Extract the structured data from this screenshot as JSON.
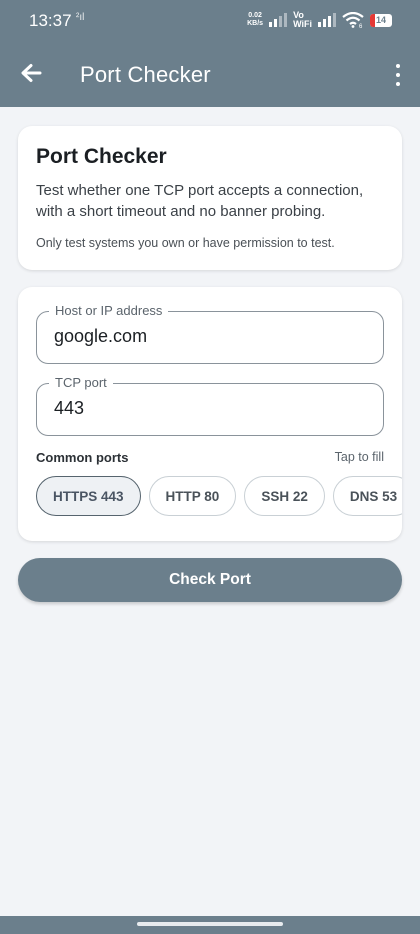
{
  "status_bar": {
    "time": "13:37",
    "sim_indicator": "²ıl",
    "net_speed_value": "0.02",
    "net_speed_unit": "KB/s",
    "vo_label": "Vo",
    "wifi_label": "WiFi",
    "wifi_sub": "6",
    "battery_level": "14"
  },
  "app_bar": {
    "title": "Port Checker",
    "back_icon": "arrow-left-icon",
    "menu_icon": "more-vert-icon"
  },
  "intro_card": {
    "title": "Port Checker",
    "description": "Test whether one TCP port accepts a connection, with a short timeout and no banner probing.",
    "notice": "Only test systems you own or have permission to test."
  },
  "form": {
    "host_label": "Host or IP address",
    "host_value": "google.com",
    "port_label": "TCP port",
    "port_value": "443",
    "common_ports_label": "Common ports",
    "tap_hint": "Tap to fill",
    "chips": [
      "HTTPS 443",
      "HTTP 80",
      "SSH 22",
      "DNS 53"
    ],
    "selected_chip": "HTTPS 443"
  },
  "action": {
    "check_label": "Check Port"
  },
  "colors": {
    "primary": "#6b7f8c",
    "background": "#f2f4f7",
    "card": "#ffffff"
  }
}
